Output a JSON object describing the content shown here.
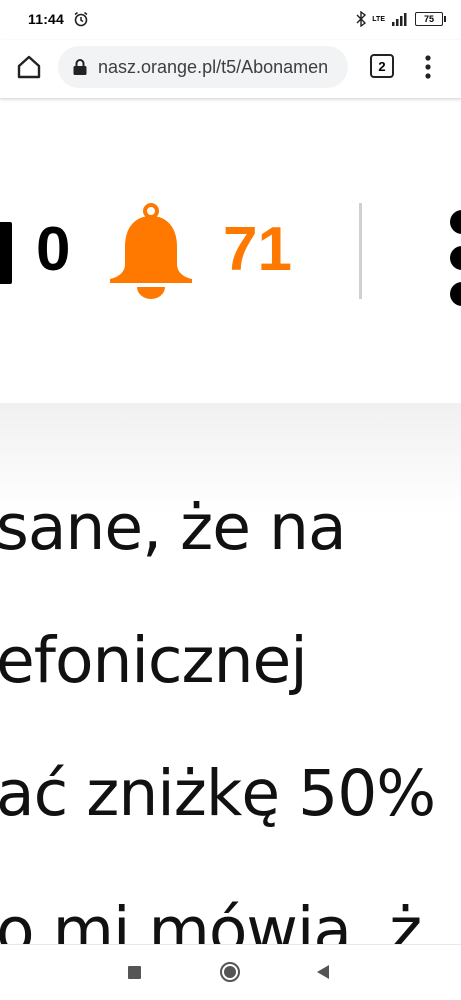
{
  "status_bar": {
    "time": "11:44",
    "network": "LTE",
    "battery": "75",
    "icons": [
      "alarm-icon",
      "bluetooth-icon",
      "signal-icon",
      "battery-icon"
    ]
  },
  "browser": {
    "url": "nasz.orange.pl/t5/Abonamen",
    "tab_count": "2",
    "icons": [
      "home-icon",
      "lock-icon",
      "tabs-icon",
      "more-vert-icon"
    ]
  },
  "header": {
    "messages_count": "0",
    "notifications_count": "71",
    "accent_color": "#ff7900",
    "icons": [
      "message-icon",
      "bell-icon",
      "more-icon"
    ]
  },
  "content": {
    "lines": [
      "sane, że na",
      "efonicznej",
      "ać zniżkę 50%",
      "o mi mówia, ż"
    ]
  },
  "navigation": {
    "icons": [
      "recents-icon",
      "home-circle-icon",
      "back-icon"
    ]
  }
}
